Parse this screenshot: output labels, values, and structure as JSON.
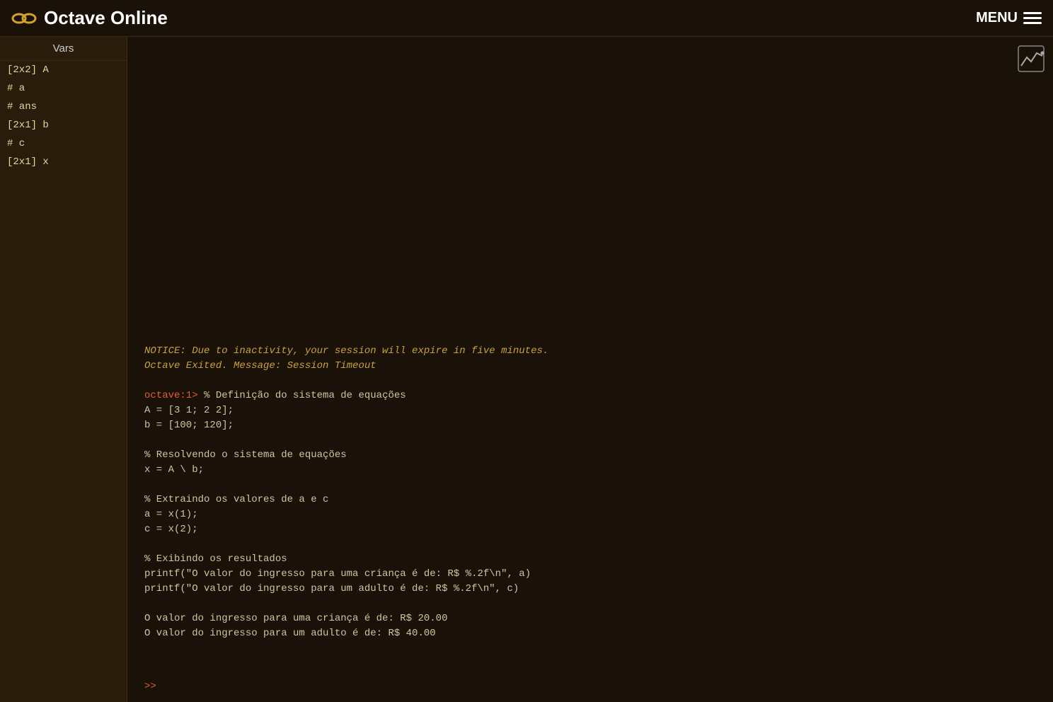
{
  "header": {
    "title": "Octave Online",
    "menu_label": "MENU"
  },
  "sidebar": {
    "header": "Vars",
    "items": [
      {
        "label": "[2x2] A"
      },
      {
        "label": "# a"
      },
      {
        "label": "# ans"
      },
      {
        "label": "[2x1] b"
      },
      {
        "label": "# c"
      },
      {
        "label": "[2x1] x"
      }
    ]
  },
  "terminal": {
    "notice_line1": "NOTICE: Due to inactivity, your session will expire in five minutes.",
    "notice_line2": "Octave Exited. Message: Session Timeout",
    "prompt": "octave:1>",
    "code_block": "% Definição do sistema de equações\nA = [3 1; 2 2];\nb = [100; 120];\n\n% Resolvendo o sistema de equações\nx = A \\ b;\n\n% Extraindo os valores de a e c\na = x(1);\nc = x(2);\n\n% Exibindo os resultados\nprintf(\"O valor do ingresso para uma criança é de: R$ %.2f\\n\", a)\nprintf(\"O valor do ingresso para um adulto é de: R$ %.2f\\n\", c)\n\nO valor do ingresso para uma criança é de: R$ 20.00\nO valor do ingresso para um adulto é de: R$ 40.00",
    "input_prompt": ">>",
    "input_value": ""
  }
}
